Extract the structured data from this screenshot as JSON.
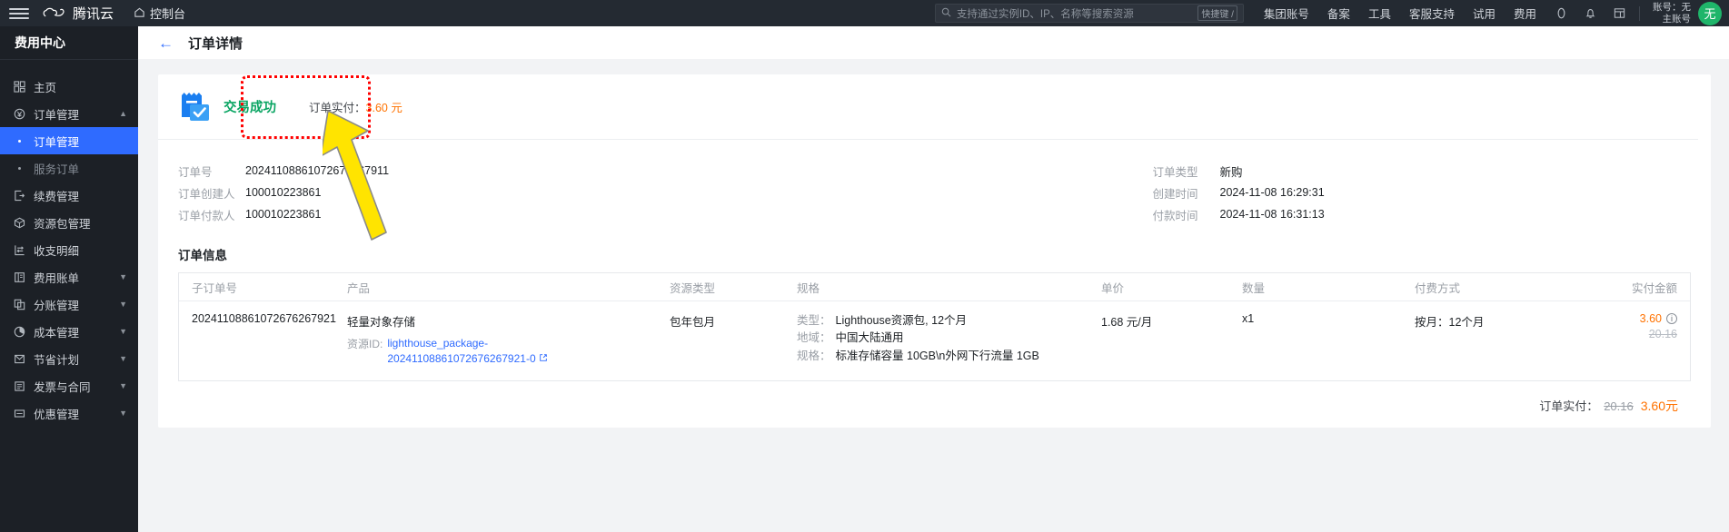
{
  "topnav": {
    "menu_icon": "hamburger-icon",
    "brand": "腾讯云",
    "console": "控制台",
    "console_icon": "home-icon",
    "search": {
      "icon": "search-icon",
      "placeholder": "支持通过实例ID、IP、名称等搜索资源",
      "shortcut": "快捷键 /"
    },
    "items": [
      "集团账号",
      "备案",
      "工具",
      "客服支持",
      "试用",
      "费用"
    ],
    "icons": [
      "link-icon",
      "bell-icon",
      "layout-icon"
    ],
    "user": {
      "line1": "账号：无",
      "line2": "主账号",
      "avatar": "无"
    }
  },
  "sidebar": {
    "title": "费用中心",
    "items": [
      {
        "label": "主页",
        "icon": "dashboard-icon",
        "chevron": false
      },
      {
        "label": "订单管理",
        "icon": "yuan-circle-icon",
        "chevron": true
      },
      {
        "label": "续费管理",
        "icon": "renew-icon",
        "chevron": false
      },
      {
        "label": "资源包管理",
        "icon": "package-icon",
        "chevron": false
      },
      {
        "label": "收支明细",
        "icon": "transfer-icon",
        "chevron": false
      },
      {
        "label": "费用账单",
        "icon": "bill-icon",
        "chevron": true
      },
      {
        "label": "分账管理",
        "icon": "split-icon",
        "chevron": true
      },
      {
        "label": "成本管理",
        "icon": "pie-icon",
        "chevron": true
      },
      {
        "label": "节省计划",
        "icon": "save-icon",
        "chevron": true
      },
      {
        "label": "发票与合同",
        "icon": "invoice-icon",
        "chevron": true
      },
      {
        "label": "优惠管理",
        "icon": "discount-icon",
        "chevron": true
      }
    ],
    "sub_items": [
      {
        "label": "订单管理",
        "active": true
      },
      {
        "label": "服务订单",
        "active": false
      }
    ]
  },
  "page": {
    "back_icon": "arrow-left-icon",
    "title": "订单详情"
  },
  "status": {
    "icon": "order-success-icon",
    "text": "交易成功",
    "pay_label": "订单实付：",
    "pay_value": "3.60 元"
  },
  "meta": {
    "left": [
      {
        "key": "订单号",
        "value": "20241108861072676267911"
      },
      {
        "key": "订单创建人",
        "value": "100010223861"
      },
      {
        "key": "订单付款人",
        "value": "100010223861"
      }
    ],
    "right": [
      {
        "key": "订单类型",
        "value": "新购"
      },
      {
        "key": "创建时间",
        "value": "2024-11-08 16:29:31"
      },
      {
        "key": "付款时间",
        "value": "2024-11-08 16:31:13"
      }
    ]
  },
  "order_info": {
    "section_title": "订单信息",
    "columns": [
      "子订单号",
      "产品",
      "资源类型",
      "规格",
      "单价",
      "数量",
      "付费方式",
      "实付金额"
    ],
    "row": {
      "sub_order_no": "20241108861072676267921",
      "product": "轻量对象存储",
      "resource_id_label": "资源ID:",
      "resource_id_value": "lighthouse_package-20241108861072676267921-0",
      "resource_link_icon": "external-link-icon",
      "resource_type": "包年包月",
      "spec": [
        {
          "key": "类型：",
          "value": "Lighthouse资源包, 12个月"
        },
        {
          "key": "地域：",
          "value": "中国大陆通用"
        },
        {
          "key": "规格：",
          "value": "标准存储容量 10GB\\n外网下行流量 1GB"
        }
      ],
      "unit_price": "1.68 元/月",
      "quantity": "x1",
      "pay_mode": "按月：12个月",
      "amount_paid": "3.60",
      "amount_info_icon": "info-icon",
      "amount_original": "20.16"
    },
    "footer": {
      "label": "订单实付：",
      "original": "20.16",
      "final": "3.60元"
    }
  },
  "annotation": {
    "box_color": "#ff0000",
    "arrow_color": "#ffe400",
    "box_name": "highlight-box",
    "arrow_name": "pointer-arrow"
  }
}
